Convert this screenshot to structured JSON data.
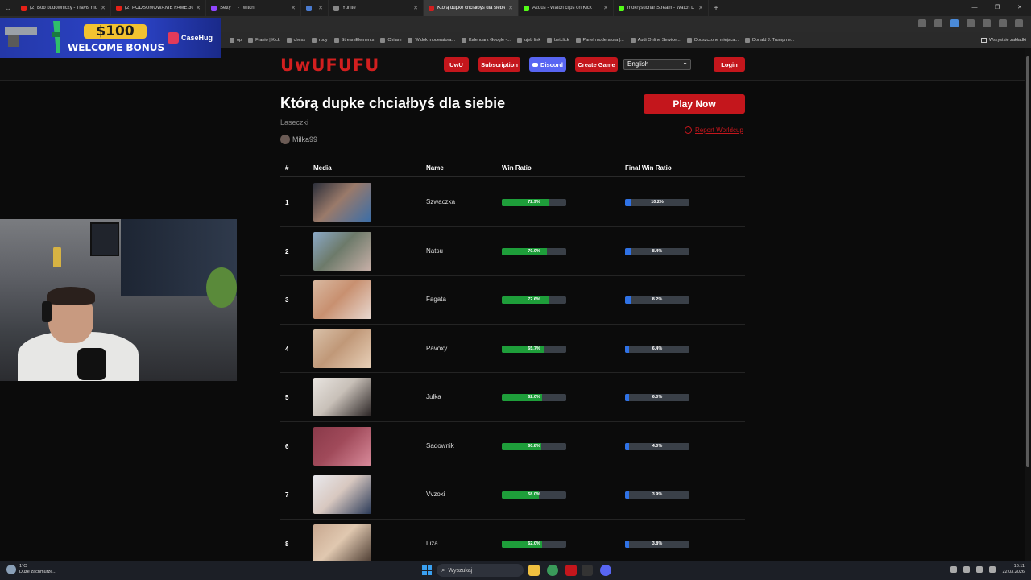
{
  "browser": {
    "tabs": [
      {
        "title": "(2) Bob budowniczy - Travis mo",
        "color": "#e62117"
      },
      {
        "title": "(2) PODSUMOWANIE FAME 30",
        "color": "#e62117"
      },
      {
        "title": "Setty__ - Twitch",
        "color": "#9146ff"
      },
      {
        "title": "",
        "color": "#4a7bd0"
      },
      {
        "title": "Yunite",
        "color": "#888888"
      },
      {
        "title": "Którą dupke chciałbyś dla siebie",
        "color": "#d21f1f",
        "active": true
      },
      {
        "title": "Azdus - Watch clips on Kick",
        "color": "#53fc18"
      },
      {
        "title": "mokrysuchar Stream - Watch L",
        "color": "#53fc18"
      }
    ],
    "bookmarks": [
      "op",
      "Franio | Kick",
      "chess",
      "rudy",
      "StreamElements",
      "Chilam",
      "Widok moderatora...",
      "Kalendarz Google -...",
      "ujeb link",
      "betclick",
      "Panel moderatora |...",
      "Audi Online Service...",
      "Opuszczone miejsca...",
      "Donald J. Trump ne..."
    ],
    "all_bookmarks": "Wszystkie zakładki"
  },
  "ad": {
    "amount": "$100",
    "text": "WELCOME BONUS",
    "brand": "CaseHug"
  },
  "site": {
    "logo": "UwUFUFU",
    "nav": {
      "uwu": "UwU",
      "subscription": "Subscription",
      "discord": "Discord",
      "create_game": "Create Game",
      "language": "English",
      "login": "Login"
    },
    "title": "Którą dupke chciałbyś dla siebie",
    "play_now": "Play Now",
    "category": "Laseczki",
    "report": "Report Worldcup",
    "author": "Milka99",
    "columns": {
      "idx": "#",
      "media": "Media",
      "name": "Name",
      "win_ratio": "Win Ratio",
      "final_win_ratio": "Final Win Ratio"
    }
  },
  "rows": [
    {
      "idx": "1",
      "name": "Szwaczka",
      "win": 72.9,
      "win_label": "72.9%",
      "final": 10.2,
      "final_label": "10.2%",
      "colors": [
        "#2c2f3a",
        "#3b6ea8",
        "#9a7a6a"
      ]
    },
    {
      "idx": "2",
      "name": "Natsu",
      "win": 70.0,
      "win_label": "70.0%",
      "final": 8.4,
      "final_label": "8.4%",
      "colors": [
        "#8aa8c6",
        "#c8b0a8",
        "#6d7a6a"
      ]
    },
    {
      "idx": "3",
      "name": "Fagata",
      "win": 72.6,
      "win_label": "72.6%",
      "final": 8.2,
      "final_label": "8.2%",
      "colors": [
        "#d8b8a0",
        "#e8d8d0",
        "#c89070"
      ]
    },
    {
      "idx": "4",
      "name": "Pavoxy",
      "win": 65.7,
      "win_label": "65.7%",
      "final": 6.4,
      "final_label": "6.4%",
      "colors": [
        "#d8c0a8",
        "#e8d0b8",
        "#c09878"
      ]
    },
    {
      "idx": "5",
      "name": "Julka",
      "win": 62.0,
      "win_label": "62.0%",
      "final": 6.0,
      "final_label": "6.0%",
      "colors": [
        "#e8e4e0",
        "#2a2424",
        "#c8c0b8"
      ]
    },
    {
      "idx": "6",
      "name": "Sadownik",
      "win": 60.8,
      "win_label": "60.8%",
      "final": 4.0,
      "final_label": "4.0%",
      "colors": [
        "#8a3a4a",
        "#d88a9a",
        "#a04a5a"
      ]
    },
    {
      "idx": "7",
      "name": "Vvzoxi",
      "win": 58.0,
      "win_label": "58.0%",
      "final": 3.9,
      "final_label": "3.9%",
      "colors": [
        "#e8e8ec",
        "#2a3a58",
        "#d8c8c0"
      ]
    },
    {
      "idx": "8",
      "name": "Liza",
      "win": 62.0,
      "win_label": "62.0%",
      "final": 3.8,
      "final_label": "3.8%",
      "colors": [
        "#c8a890",
        "#4a3a30",
        "#e0c8b0"
      ]
    }
  ],
  "taskbar": {
    "weather_temp": "1°C",
    "weather_desc": "Duże zachmurze...",
    "search": "Wyszukaj",
    "time": "16:11",
    "date": "22.03.2026"
  }
}
